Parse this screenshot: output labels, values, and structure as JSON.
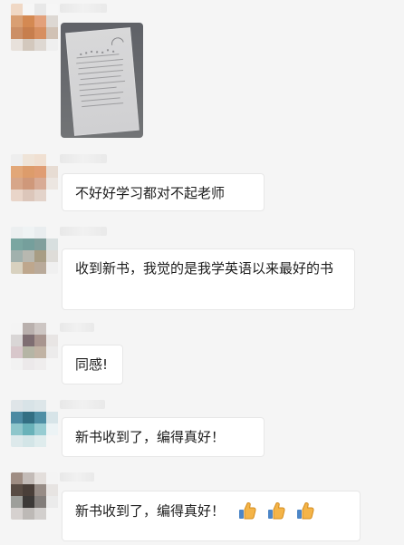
{
  "messages": [
    {
      "type": "image"
    },
    {
      "type": "text",
      "text": "不好好学习都对不起老师"
    },
    {
      "type": "text",
      "text": "收到新书，我觉的是我学英语以来最好的书"
    },
    {
      "type": "text",
      "text": "同感!"
    },
    {
      "type": "text",
      "text": "新书收到了，编得真好！"
    },
    {
      "type": "text_with_emoji",
      "text": "新书收到了，编得真好！",
      "emojis": [
        "thumbs-up",
        "thumbs-up",
        "thumbs-up"
      ]
    }
  ]
}
